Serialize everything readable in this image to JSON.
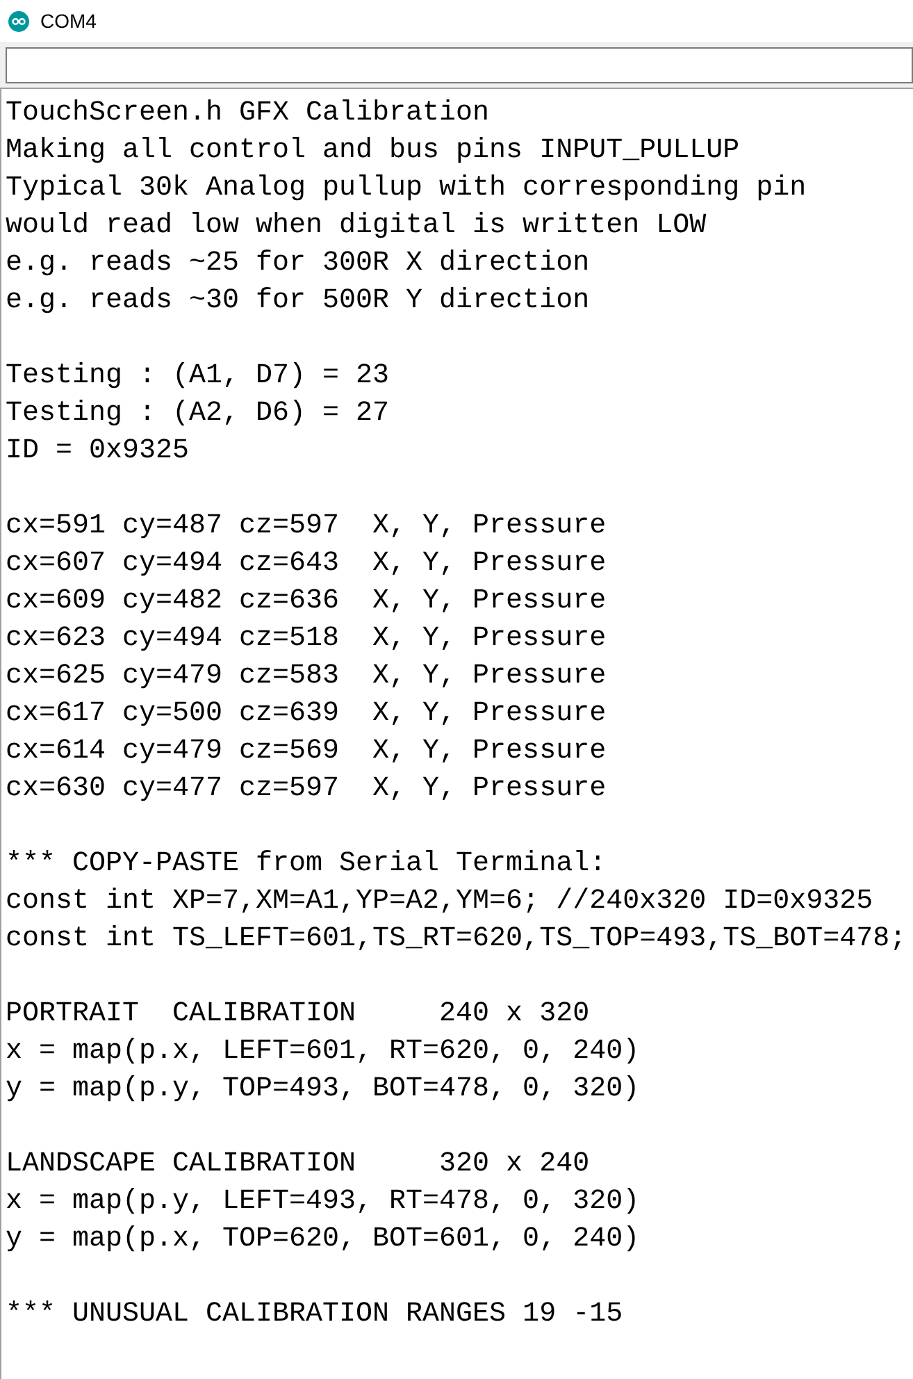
{
  "window": {
    "title": "COM4"
  },
  "output": {
    "blocks": [
      [
        "TouchScreen.h GFX Calibration",
        "Making all control and bus pins INPUT_PULLUP",
        "Typical 30k Analog pullup with corresponding pin",
        "would read low when digital is written LOW",
        "e.g. reads ~25 for 300R X direction",
        "e.g. reads ~30 for 500R Y direction"
      ],
      [
        "Testing : (A1, D7) = 23",
        "Testing : (A2, D6) = 27",
        "ID = 0x9325"
      ],
      [
        "cx=591 cy=487 cz=597  X, Y, Pressure",
        "cx=607 cy=494 cz=643  X, Y, Pressure",
        "cx=609 cy=482 cz=636  X, Y, Pressure",
        "cx=623 cy=494 cz=518  X, Y, Pressure",
        "cx=625 cy=479 cz=583  X, Y, Pressure",
        "cx=617 cy=500 cz=639  X, Y, Pressure",
        "cx=614 cy=479 cz=569  X, Y, Pressure",
        "cx=630 cy=477 cz=597  X, Y, Pressure"
      ],
      [
        "*** COPY-PASTE from Serial Terminal:",
        "const int XP=7,XM=A1,YP=A2,YM=6; //240x320 ID=0x9325",
        "const int TS_LEFT=601,TS_RT=620,TS_TOP=493,TS_BOT=478;"
      ],
      [
        "PORTRAIT  CALIBRATION     240 x 320",
        "x = map(p.x, LEFT=601, RT=620, 0, 240)",
        "y = map(p.y, TOP=493, BOT=478, 0, 320)"
      ],
      [
        "LANDSCAPE CALIBRATION     320 x 240",
        "x = map(p.y, LEFT=493, RT=478, 0, 320)",
        "y = map(p.x, TOP=620, BOT=601, 0, 240)"
      ],
      [
        "*** UNUSUAL CALIBRATION RANGES 19 -15"
      ]
    ]
  }
}
